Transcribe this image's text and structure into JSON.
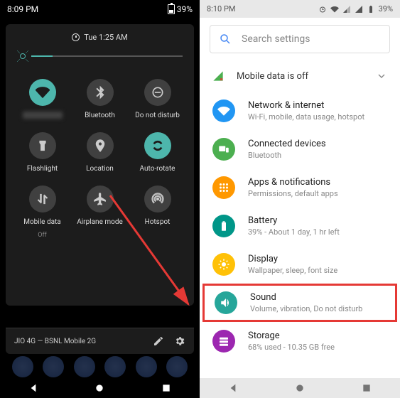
{
  "left": {
    "status_time": "8:09 PM",
    "battery_pct": "39%",
    "alarm_time": "Tue 1:25 AM",
    "tiles": [
      {
        "label": "",
        "sub": "",
        "blurred": true,
        "on": true,
        "icon": "wifi"
      },
      {
        "label": "Bluetooth",
        "on": false,
        "icon": "bluetooth"
      },
      {
        "label": "Do not disturb",
        "on": false,
        "icon": "dnd"
      },
      {
        "label": "Flashlight",
        "on": false,
        "icon": "flashlight"
      },
      {
        "label": "Location",
        "on": false,
        "icon": "location"
      },
      {
        "label": "Auto-rotate",
        "on": true,
        "icon": "rotate"
      },
      {
        "label": "Mobile data",
        "sub": "Off",
        "on": false,
        "icon": "mobiledata"
      },
      {
        "label": "Airplane mode",
        "on": false,
        "icon": "airplane"
      },
      {
        "label": "Hotspot",
        "on": false,
        "icon": "hotspot"
      }
    ],
    "carrier": "JIO 4G — BSNL Mobile 2G"
  },
  "right": {
    "status_time": "8:10 PM",
    "battery_pct": "39%",
    "search_placeholder": "Search settings",
    "notice": "Mobile data is off",
    "items": [
      {
        "title": "Network & internet",
        "sub": "Wi-Fi, mobile, data usage, hotspot",
        "color": "c-blue",
        "icon": "wifi"
      },
      {
        "title": "Connected devices",
        "sub": "Bluetooth",
        "color": "c-green",
        "icon": "devices"
      },
      {
        "title": "Apps & notifications",
        "sub": "Permissions, default apps",
        "color": "c-orange",
        "icon": "apps"
      },
      {
        "title": "Battery",
        "sub": "39% - About 1 day, 1 hr left",
        "color": "c-teal",
        "icon": "battery"
      },
      {
        "title": "Display",
        "sub": "Wallpaper, sleep, font size",
        "color": "c-amber",
        "icon": "display"
      },
      {
        "title": "Sound",
        "sub": "Volume, vibration, Do not disturb",
        "color": "c-tealD",
        "icon": "sound",
        "highlight": true
      },
      {
        "title": "Storage",
        "sub": "68% used - 10.35 GB free",
        "color": "c-purple",
        "icon": "storage"
      }
    ]
  }
}
